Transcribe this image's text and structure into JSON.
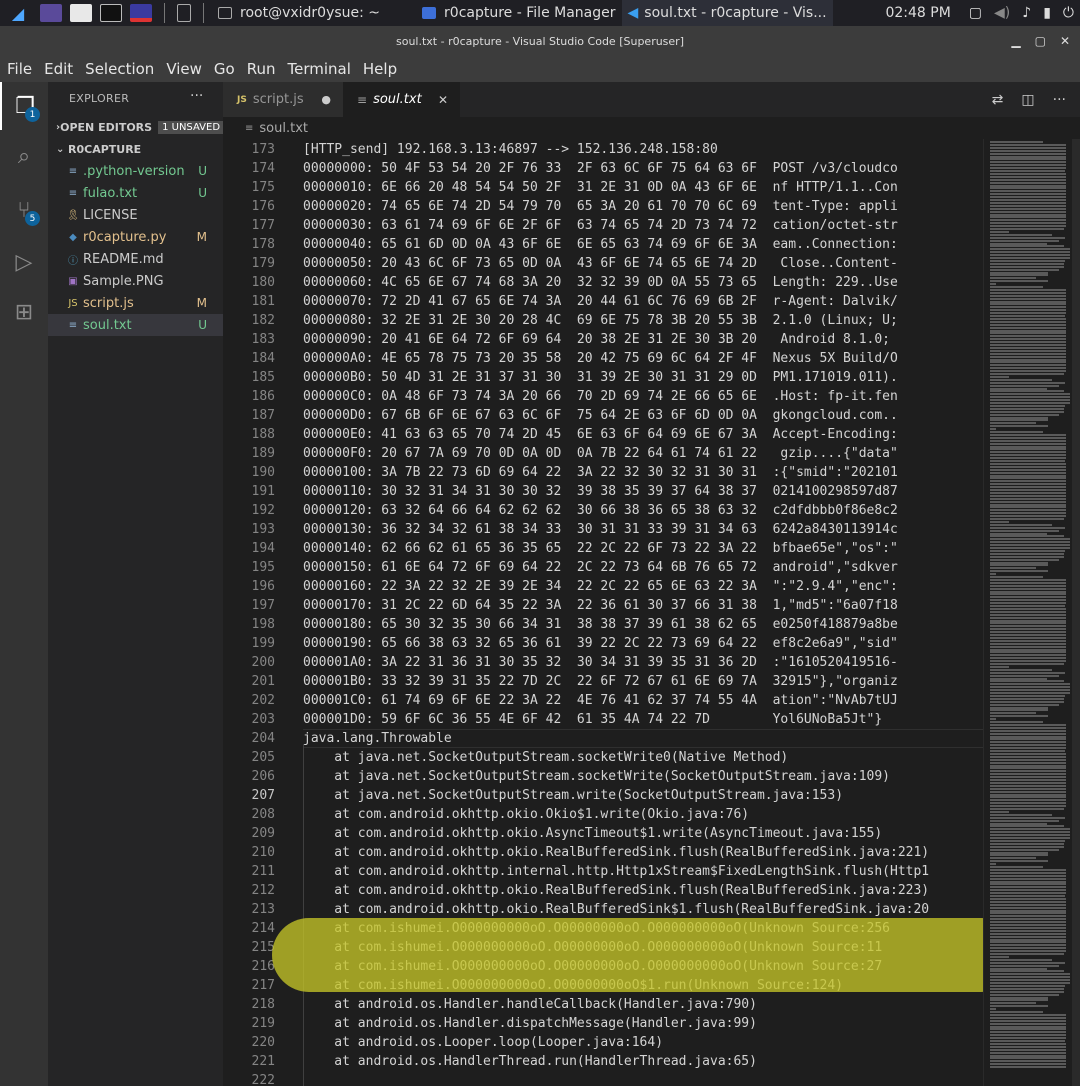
{
  "taskbar": {
    "tasks": [
      {
        "label": "root@vxidr0ysue: ~"
      },
      {
        "label": "r0capture - File Manager"
      },
      {
        "label": "soul.txt - r0capture - Vis..."
      }
    ],
    "clock": "02:48 PM"
  },
  "window": {
    "title": "soul.txt - r0capture - Visual Studio Code [Superuser]"
  },
  "menu": [
    "File",
    "Edit",
    "Selection",
    "View",
    "Go",
    "Run",
    "Terminal",
    "Help"
  ],
  "activity": {
    "explorer_badge": "1",
    "scm_badge": "5"
  },
  "sidebar": {
    "title": "EXPLORER",
    "open_editors": "OPEN EDITORS",
    "unsaved": "1 UNSAVED",
    "project": "R0CAPTURE",
    "files": [
      {
        "name": ".python-version",
        "status": "U",
        "icon": "≡",
        "icon_color": "#8fb0d0",
        "color": "#73c991"
      },
      {
        "name": "fulao.txt",
        "status": "U",
        "icon": "≡",
        "icon_color": "#8fb0d0",
        "color": "#73c991"
      },
      {
        "name": "LICENSE",
        "status": "",
        "icon": "🎗",
        "icon_color": "#d7ba7d",
        "color": "#cccccc"
      },
      {
        "name": "r0capture.py",
        "status": "M",
        "icon": "◆",
        "icon_color": "#4b8bbe",
        "color": "#e2c08d"
      },
      {
        "name": "README.md",
        "status": "",
        "icon": "ⓘ",
        "icon_color": "#519aba",
        "color": "#cccccc"
      },
      {
        "name": "Sample.PNG",
        "status": "",
        "icon": "▣",
        "icon_color": "#a074c4",
        "color": "#cccccc"
      },
      {
        "name": "script.js",
        "status": "M",
        "icon": "JS",
        "icon_color": "#d6c36a",
        "color": "#e2c08d"
      },
      {
        "name": "soul.txt",
        "status": "U",
        "icon": "≡",
        "icon_color": "#8fb0d0",
        "color": "#73c991"
      }
    ]
  },
  "tabs": [
    {
      "label": "script.js",
      "modified_dot": "●"
    },
    {
      "label": "soul.txt",
      "close": "✕"
    }
  ],
  "breadcrumb": "soul.txt",
  "colors": {
    "class": "#4ec9b0",
    "method": "#dcdcaa",
    "text": "#d4d4d4",
    "highlight": "#c4c428"
  },
  "code_lines": [
    {
      "n": "173",
      "t": "[HTTP_send] 192.168.3.13:46897 --> 152.136.248.158:80"
    },
    {
      "n": "174",
      "t": "00000000: 50 4F 53 54 20 2F 76 33  2F 63 6C 6F 75 64 63 6F  POST /v3/cloudco"
    },
    {
      "n": "175",
      "t": "00000010: 6E 66 20 48 54 54 50 2F  31 2E 31 0D 0A 43 6F 6E  nf HTTP/1.1..Con"
    },
    {
      "n": "176",
      "t": "00000020: 74 65 6E 74 2D 54 79 70  65 3A 20 61 70 70 6C 69  tent-Type: appli"
    },
    {
      "n": "177",
      "t": "00000030: 63 61 74 69 6F 6E 2F 6F  63 74 65 74 2D 73 74 72  cation/octet-str"
    },
    {
      "n": "178",
      "t": "00000040: 65 61 6D 0D 0A 43 6F 6E  6E 65 63 74 69 6F 6E 3A  eam..Connection:"
    },
    {
      "n": "179",
      "t": "00000050: 20 43 6C 6F 73 65 0D 0A  43 6F 6E 74 65 6E 74 2D   Close..Content-"
    },
    {
      "n": "180",
      "t": "00000060: 4C 65 6E 67 74 68 3A 20  32 32 39 0D 0A 55 73 65  Length: 229..Use"
    },
    {
      "n": "181",
      "t": "00000070: 72 2D 41 67 65 6E 74 3A  20 44 61 6C 76 69 6B 2F  r-Agent: Dalvik/"
    },
    {
      "n": "182",
      "t": "00000080: 32 2E 31 2E 30 20 28 4C  69 6E 75 78 3B 20 55 3B  2.1.0 (Linux; U;"
    },
    {
      "n": "183",
      "t": "00000090: 20 41 6E 64 72 6F 69 64  20 38 2E 31 2E 30 3B 20   Android 8.1.0;"
    },
    {
      "n": "184",
      "t": "000000A0: 4E 65 78 75 73 20 35 58  20 42 75 69 6C 64 2F 4F  Nexus 5X Build/O"
    },
    {
      "n": "185",
      "t": "000000B0: 50 4D 31 2E 31 37 31 30  31 39 2E 30 31 31 29 0D  PM1.171019.011)."
    },
    {
      "n": "186",
      "t": "000000C0: 0A 48 6F 73 74 3A 20 66  70 2D 69 74 2E 66 65 6E  .Host: fp-it.fen"
    },
    {
      "n": "187",
      "t": "000000D0: 67 6B 6F 6E 67 63 6C 6F  75 64 2E 63 6F 6D 0D 0A  gkongcloud.com.."
    },
    {
      "n": "188",
      "t": "000000E0: 41 63 63 65 70 74 2D 45  6E 63 6F 64 69 6E 67 3A  Accept-Encoding:"
    },
    {
      "n": "189",
      "t": "000000F0: 20 67 7A 69 70 0D 0A 0D  0A 7B 22 64 61 74 61 22   gzip....{\"data\""
    },
    {
      "n": "190",
      "t": "00000100: 3A 7B 22 73 6D 69 64 22  3A 22 32 30 32 31 30 31  :{\"smid\":\"202101"
    },
    {
      "n": "191",
      "t": "00000110: 30 32 31 34 31 30 30 32  39 38 35 39 37 64 38 37  0214100298597d87"
    },
    {
      "n": "192",
      "t": "00000120: 63 32 64 66 64 62 62 62  30 66 38 36 65 38 63 32  c2dfdbbb0f86e8c2"
    },
    {
      "n": "193",
      "t": "00000130: 36 32 34 32 61 38 34 33  30 31 31 33 39 31 34 63  6242a8430113914c"
    },
    {
      "n": "194",
      "t": "00000140: 62 66 62 61 65 36 35 65  22 2C 22 6F 73 22 3A 22  bfbae65e\",\"os\":\""
    },
    {
      "n": "195",
      "t": "00000150: 61 6E 64 72 6F 69 64 22  2C 22 73 64 6B 76 65 72  android\",\"sdkver"
    },
    {
      "n": "196",
      "t": "00000160: 22 3A 22 32 2E 39 2E 34  22 2C 22 65 6E 63 22 3A  \":\"2.9.4\",\"enc\":"
    },
    {
      "n": "197",
      "t": "00000170: 31 2C 22 6D 64 35 22 3A  22 36 61 30 37 66 31 38  1,\"md5\":\"6a07f18"
    },
    {
      "n": "198",
      "t": "00000180: 65 30 32 35 30 66 34 31  38 38 37 39 61 38 62 65  e0250f418879a8be"
    },
    {
      "n": "199",
      "t": "00000190: 65 66 38 63 32 65 36 61  39 22 2C 22 73 69 64 22  ef8c2e6a9\",\"sid\""
    },
    {
      "n": "200",
      "t": "000001A0: 3A 22 31 36 31 30 35 32  30 34 31 39 35 31 36 2D  :\"1610520419516-"
    },
    {
      "n": "201",
      "t": "000001B0: 33 32 39 31 35 22 7D 2C  22 6F 72 67 61 6E 69 7A  32915\"},\"organiz"
    },
    {
      "n": "202",
      "t": "000001C0: 61 74 69 6F 6E 22 3A 22  4E 76 41 62 37 74 55 4A  ation\":\"NvAb7tUJ"
    },
    {
      "n": "203",
      "t": "000001D0: 59 6F 6C 36 55 4E 6F 42  61 35 4A 74 22 7D        Yol6UNoBa5Jt\"}"
    },
    {
      "n": "204",
      "t": "java.lang.Throwable"
    },
    {
      "n": "205",
      "t": "    at java.net.SocketOutputStream.socketWrite0(Native Method)"
    },
    {
      "n": "206",
      "t": "    at java.net.SocketOutputStream.socketWrite(SocketOutputStream.java:109)"
    },
    {
      "n": "207",
      "t": "    at java.net.SocketOutputStream.write(SocketOutputStream.java:153)"
    },
    {
      "n": "208",
      "t": "    at com.android.okhttp.okio.Okio$1.write(Okio.java:76)"
    },
    {
      "n": "209",
      "t": "    at com.android.okhttp.okio.AsyncTimeout$1.write(AsyncTimeout.java:155)"
    },
    {
      "n": "210",
      "t": "    at com.android.okhttp.okio.RealBufferedSink.flush(RealBufferedSink.java:221)"
    },
    {
      "n": "211",
      "t": "    at com.android.okhttp.internal.http.Http1xStream$FixedLengthSink.flush(Http1"
    },
    {
      "n": "212",
      "t": "    at com.android.okhttp.okio.RealBufferedSink.flush(RealBufferedSink.java:223)"
    },
    {
      "n": "213",
      "t": "    at com.android.okhttp.okio.RealBufferedSink$1.flush(RealBufferedSink.java:20"
    },
    {
      "n": "214",
      "t": "    at com.ishumei.O000000000oO.O00000000oO.O000000000oO(Unknown Source:256"
    },
    {
      "n": "215",
      "t": "    at com.ishumei.O000000000oO.O00000000oO.O000000000oO(Unknown Source:11"
    },
    {
      "n": "216",
      "t": "    at com.ishumei.O000000000oO.O00000000oO.O000000000oO(Unknown Source:27"
    },
    {
      "n": "217",
      "t": "    at com.ishumei.O000000000oO.O00000000oO$1.run(Unknown Source:124)"
    },
    {
      "n": "218",
      "t": "    at android.os.Handler.handleCallback(Handler.java:790)"
    },
    {
      "n": "219",
      "t": "    at android.os.Handler.dispatchMessage(Handler.java:99)"
    },
    {
      "n": "220",
      "t": "    at android.os.Looper.loop(Looper.java:164)"
    },
    {
      "n": "221",
      "t": "    at android.os.HandlerThread.run(HandlerThread.java:65)"
    },
    {
      "n": "222",
      "t": ""
    }
  ]
}
